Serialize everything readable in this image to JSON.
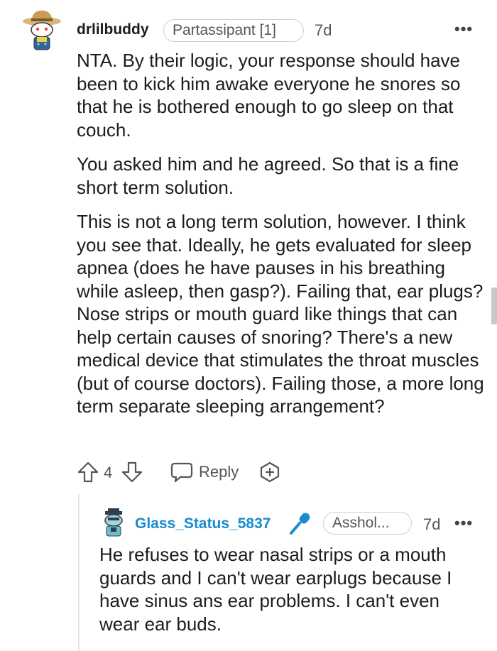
{
  "comment": {
    "username": "drlilbuddy",
    "flair": "Partassipant [1]",
    "time": "7d",
    "more": "•••",
    "paragraphs": [
      "NTA. By their logic, your response should have been to kick him awake everyone he snores so that he is bothered enough to go sleep on that couch.",
      "You asked him and he agreed. So that is a fine short term solution.",
      "This is not a long term solution, however. I think you see that. Ideally, he gets evaluated for sleep apnea (does he have pauses in his breathing while asleep, then gasp?). Failing that, ear plugs? Nose strips or mouth guard like things that can help certain causes of snoring? There's a new medical device that stimulates the throat muscles (but of course doctors). Failing those, a more long term separate sleeping arrangement?"
    ],
    "vote_count": "4",
    "reply_label": "Reply"
  },
  "reply": {
    "username": "Glass_Status_5837",
    "flair": "Asshol...",
    "time": "7d",
    "more": "•••",
    "text": "He refuses to wear nasal strips or a mouth guards and I can't wear earplugs because I have sinus ans ear problems. I can't even wear ear buds."
  },
  "colors": {
    "op_badge": "#1a8bd1",
    "text": "#1c1c1c",
    "muted": "#555555"
  },
  "icons": {
    "upvote": "upvote-arrow-icon",
    "downvote": "downvote-arrow-icon",
    "reply": "speech-bubble-icon",
    "award": "award-plus-icon",
    "op": "microphone-icon"
  }
}
